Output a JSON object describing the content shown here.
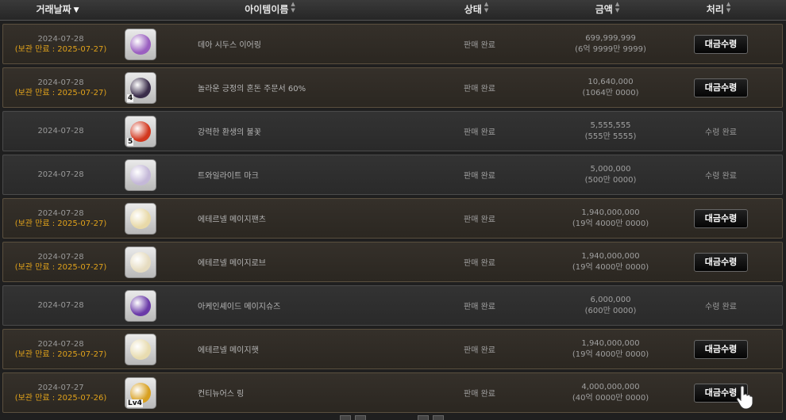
{
  "header": {
    "date": "거래날짜",
    "item_name": "아이템이름",
    "status": "상태",
    "amount": "금액",
    "action": "처리"
  },
  "rows": [
    {
      "date": "2024-07-28",
      "expire": "(보관 만료 : 2025-07-27)",
      "name": "데아 시두스 이어링",
      "status": "판매 완료",
      "price": "699,999,999",
      "price_kr": "(6억 9999만 9999)",
      "action": "대금수령",
      "done": false,
      "badge": "",
      "icon_color": "#9a5fc0"
    },
    {
      "date": "2024-07-28",
      "expire": "(보관 만료 : 2025-07-27)",
      "name": "놀라운 긍정의 혼돈 주문서 60%",
      "status": "판매 완료",
      "price": "10,640,000",
      "price_kr": "(1064만 0000)",
      "action": "대금수령",
      "done": false,
      "badge": "4",
      "icon_color": "#3a2d4a"
    },
    {
      "date": "2024-07-28",
      "expire": "",
      "name": "강력한 환생의 불꽃",
      "status": "판매 완료",
      "price": "5,555,555",
      "price_kr": "(555만 5555)",
      "action": "수령 완료",
      "done": true,
      "badge": "5",
      "icon_color": "#d2381f"
    },
    {
      "date": "2024-07-28",
      "expire": "",
      "name": "트와일라이트 마크",
      "status": "판매 완료",
      "price": "5,000,000",
      "price_kr": "(500만 0000)",
      "action": "수령 완료",
      "done": true,
      "badge": "",
      "icon_color": "#c4b8d8"
    },
    {
      "date": "2024-07-28",
      "expire": "(보관 만료 : 2025-07-27)",
      "name": "에테르넬 메이지팬츠",
      "status": "판매 완료",
      "price": "1,940,000,000",
      "price_kr": "(19억 4000만 0000)",
      "action": "대금수령",
      "done": false,
      "badge": "",
      "icon_color": "#e8d9a8"
    },
    {
      "date": "2024-07-28",
      "expire": "(보관 만료 : 2025-07-27)",
      "name": "에테르넬 메이지로브",
      "status": "판매 완료",
      "price": "1,940,000,000",
      "price_kr": "(19억 4000만 0000)",
      "action": "대금수령",
      "done": false,
      "badge": "",
      "icon_color": "#e6dcc0"
    },
    {
      "date": "2024-07-28",
      "expire": "",
      "name": "아케인셰이드 메이지슈즈",
      "status": "판매 완료",
      "price": "6,000,000",
      "price_kr": "(600만 0000)",
      "action": "수령 완료",
      "done": true,
      "badge": "",
      "icon_color": "#6a3aa8"
    },
    {
      "date": "2024-07-28",
      "expire": "(보관 만료 : 2025-07-27)",
      "name": "에테르넬 메이지햇",
      "status": "판매 완료",
      "price": "1,940,000,000",
      "price_kr": "(19억 4000만 0000)",
      "action": "대금수령",
      "done": false,
      "badge": "",
      "icon_color": "#e8dcb0"
    },
    {
      "date": "2024-07-27",
      "expire": "(보관 만료 : 2025-07-26)",
      "name": "컨티뉴어스 링",
      "status": "판매 완료",
      "price": "4,000,000,000",
      "price_kr": "(40억 0000만 0000)",
      "action": "대금수령",
      "done": false,
      "badge": "Lv4",
      "icon_color": "#d8a020"
    }
  ]
}
